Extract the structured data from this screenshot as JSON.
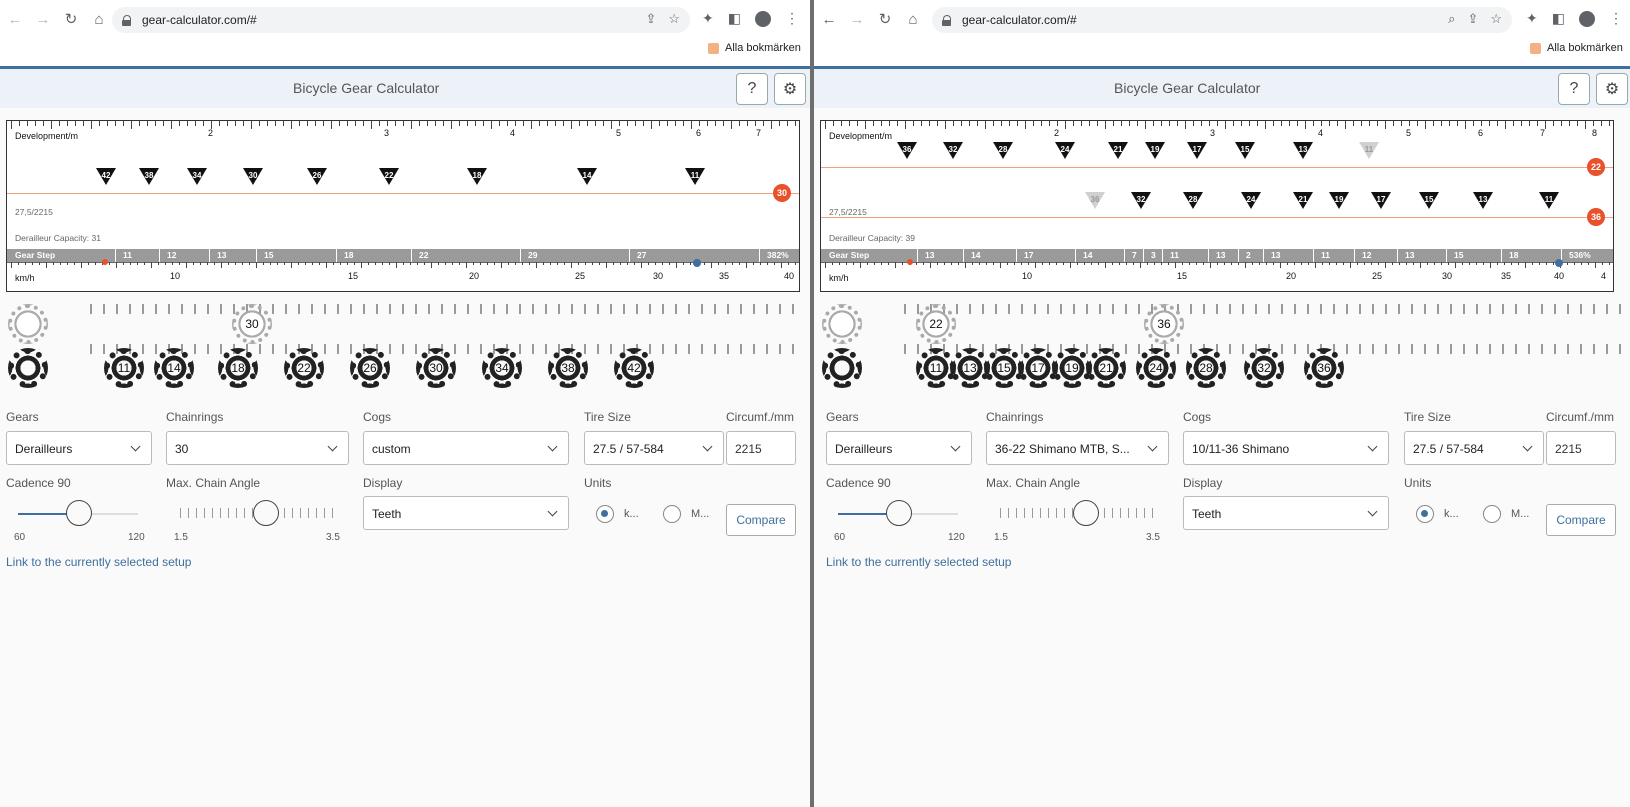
{
  "browser": {
    "url": "gear-calculator.com/#",
    "bookmarks_label": "Alla bokmärken"
  },
  "app": {
    "title": "Bicycle Gear Calculator",
    "help_label": "?",
    "settings_label": "⚙"
  },
  "chart_labels": {
    "development": "Development/m",
    "gear_step": "Gear Step",
    "kmh": "km/h",
    "setup": "27,5/2215"
  },
  "left": {
    "derailleur_capacity": "Derailleur Capacity: 31",
    "dev_ticks": [
      "2",
      "3",
      "4",
      "5",
      "6",
      "7"
    ],
    "kmh_ticks": [
      "10",
      "15",
      "20",
      "25",
      "30",
      "35",
      "40"
    ],
    "row1": {
      "cogs": [
        "42",
        "38",
        "34",
        "30",
        "26",
        "22",
        "18",
        "14",
        "11"
      ],
      "chainring": "30"
    },
    "gear_steps": [
      "11",
      "12",
      "13",
      "15",
      "18",
      "22",
      "29",
      "27",
      "382%"
    ],
    "chainrings": [
      "30"
    ],
    "cogs": [
      "11",
      "14",
      "18",
      "22",
      "26",
      "30",
      "34",
      "38",
      "42"
    ],
    "form": {
      "gears_label": "Gears",
      "gears_value": "Derailleurs",
      "chainrings_label": "Chainrings",
      "chainrings_value": "30",
      "cogs_label": "Cogs",
      "cogs_value": "custom",
      "tire_label": "Tire Size",
      "tire_value": "27.5 / 57-584",
      "circ_label": "Circumf./mm",
      "circ_value": "2215",
      "cadence_label": "Cadence 90",
      "cadence_min": "60",
      "cadence_max": "120",
      "angle_label": "Max. Chain Angle",
      "angle_min": "1.5",
      "angle_max": "3.5",
      "display_label": "Display",
      "display_value": "Teeth",
      "units_label": "Units",
      "unit_a": "k...",
      "unit_b": "M...",
      "compare": "Compare",
      "link": "Link to the currently selected setup"
    }
  },
  "right": {
    "derailleur_capacity": "Derailleur Capacity: 39",
    "dev_ticks": [
      "2",
      "3",
      "4",
      "5",
      "6",
      "7",
      "8"
    ],
    "kmh_ticks": [
      "10",
      "15",
      "20",
      "25",
      "30",
      "35",
      "40",
      "4"
    ],
    "row1": {
      "cogs": [
        "36",
        "32",
        "28",
        "24",
        "21",
        "19",
        "17",
        "15",
        "13",
        "11"
      ],
      "chainring": "22"
    },
    "row2": {
      "cogs": [
        "36",
        "32",
        "28",
        "24",
        "21",
        "19",
        "17",
        "15",
        "13",
        "11"
      ],
      "chainring": "36"
    },
    "gear_steps": [
      "13",
      "14",
      "17",
      "14",
      "7",
      "3",
      "11",
      "13",
      "2",
      "13",
      "11",
      "12",
      "13",
      "15",
      "18",
      "536%"
    ],
    "chainrings": [
      "22",
      "36"
    ],
    "cogs": [
      "11",
      "13",
      "15",
      "17",
      "19",
      "21",
      "24",
      "28",
      "32",
      "36"
    ],
    "form": {
      "gears_label": "Gears",
      "gears_value": "Derailleurs",
      "chainrings_label": "Chainrings",
      "chainrings_value": "36-22 Shimano MTB, S...",
      "cogs_label": "Cogs",
      "cogs_value": "10/11-36 Shimano",
      "tire_label": "Tire Size",
      "tire_value": "27.5 / 57-584",
      "circ_label": "Circumf./mm",
      "circ_value": "2215",
      "cadence_label": "Cadence 90",
      "cadence_min": "60",
      "cadence_max": "120",
      "angle_label": "Max. Chain Angle",
      "angle_min": "1.5",
      "angle_max": "3.5",
      "display_label": "Display",
      "display_value": "Teeth",
      "units_label": "Units",
      "unit_a": "k...",
      "unit_b": "M...",
      "compare": "Compare",
      "link": "Link to the currently selected setup"
    }
  },
  "colors": {
    "accent": "#3e6f9e",
    "chainring": "#e8512a",
    "line": "#f3a07e"
  }
}
